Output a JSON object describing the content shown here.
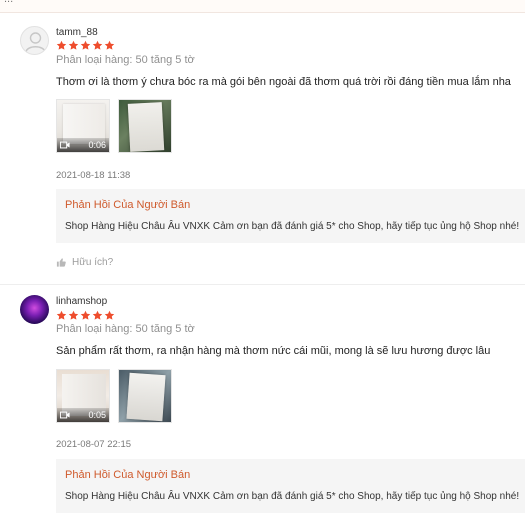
{
  "reviews": [
    {
      "username": "tamm_88",
      "rating": 5,
      "variant": "Phân loại hàng: 50 tăng 5 tờ",
      "text": "Thơm ơi là thơm ý chưa bóc ra mà gói bên ngoài đã thơm quá trời rồi đáng tiền mua lắm nha",
      "video_duration": "0:06",
      "date": "2021-08-18 11:38",
      "seller_reply_title": "Phản Hồi Của Người Bán",
      "seller_reply_text": "Shop Hàng Hiệu Châu Âu VNXK Cảm ơn bạn đã đánh giá 5* cho Shop, hãy tiếp tục ủng hộ Shop nhé!",
      "helpful_label": "Hữu ích?"
    },
    {
      "username": "linhamshop",
      "rating": 5,
      "variant": "Phân loại hàng: 50 tăng 5 tờ",
      "text": "Sản phẩm rất thơm, ra nhận hàng mà thơm nức cái mũi, mong là sẽ lưu hương được lâu",
      "video_duration": "0:05",
      "date": "2021-08-07 22:15",
      "seller_reply_title": "Phản Hồi Của Người Bán",
      "seller_reply_text": "Shop Hàng Hiệu Châu Âu VNXK Cảm ơn bạn đã đánh giá 5* cho Shop, hãy tiếp tục ủng hộ Shop nhé!"
    }
  ],
  "icons": {
    "star": "star-icon",
    "video": "video-camera-icon",
    "thumbs_up": "thumbs-up-icon",
    "avatar_default": "user-icon"
  },
  "colors": {
    "star": "#ee4d2d",
    "seller_title": "#cf5a2c",
    "seller_bg": "#f5f5f5"
  }
}
